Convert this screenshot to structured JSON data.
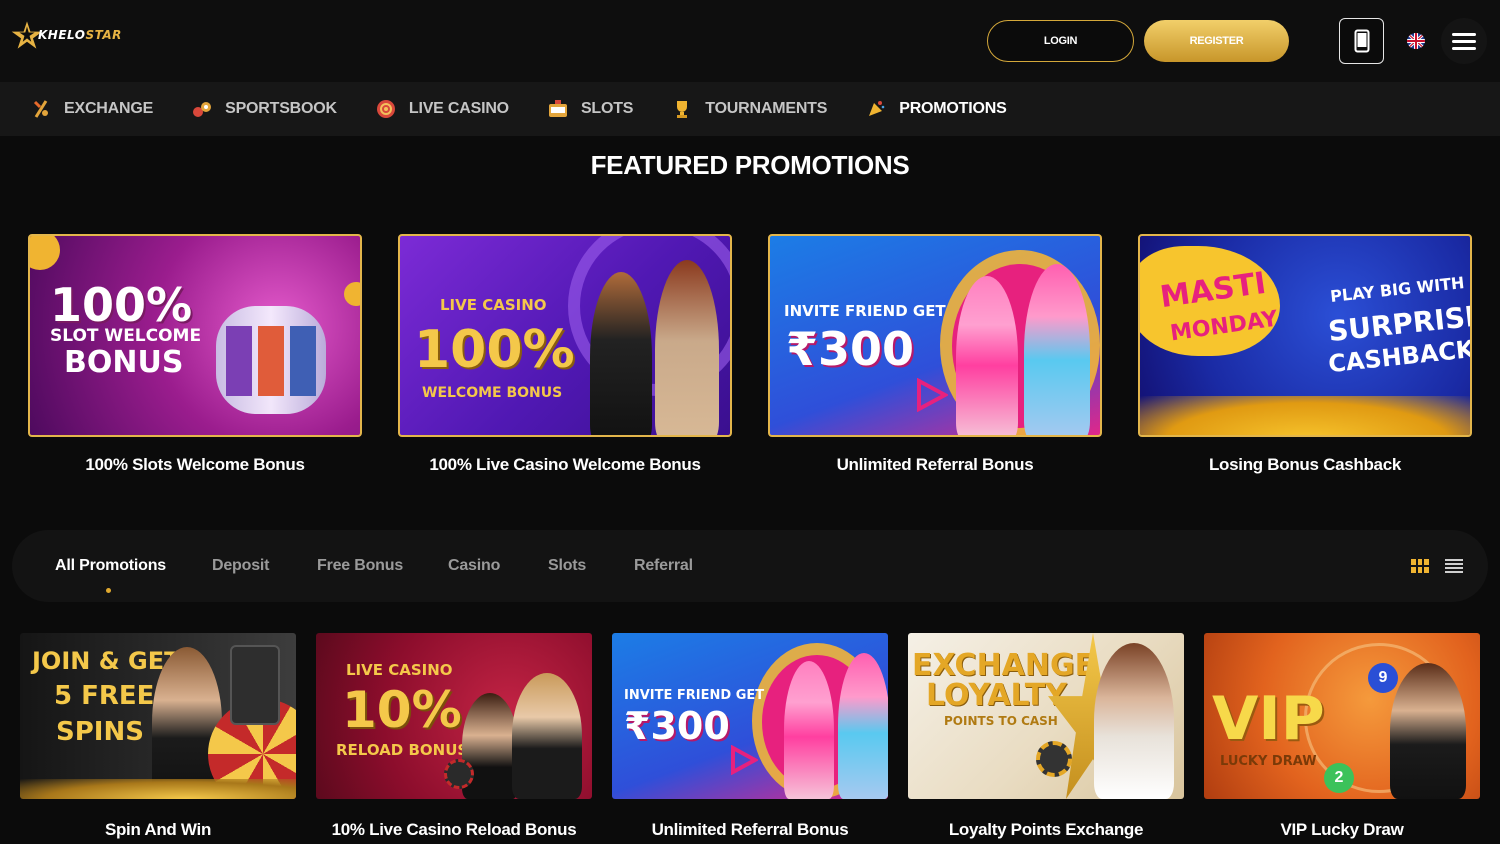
{
  "header": {
    "logo_text_1": "KHELO",
    "logo_text_2": "STAR",
    "login_label": "LOGIN",
    "register_label": "REGISTER"
  },
  "nav": {
    "items": [
      {
        "label": "EXCHANGE",
        "icon": "exchange-icon"
      },
      {
        "label": "SPORTSBOOK",
        "icon": "sportsbook-icon"
      },
      {
        "label": "LIVE CASINO",
        "icon": "live-casino-icon"
      },
      {
        "label": "SLOTS",
        "icon": "slots-icon"
      },
      {
        "label": "TOURNAMENTS",
        "icon": "trophy-icon"
      },
      {
        "label": "PROMOTIONS",
        "icon": "promotions-icon"
      }
    ],
    "active": "PROMOTIONS"
  },
  "featured": {
    "title": "FEATURED PROMOTIONS",
    "cards": [
      {
        "label": "100% Slots Welcome Bonus",
        "banner": {
          "line1": "100%",
          "line2": "SLOT WELCOME",
          "line3": "BONUS"
        }
      },
      {
        "label": "100% Live Casino Welcome Bonus",
        "banner": {
          "line1": "LIVE CASINO",
          "line2": "100%",
          "line3": "WELCOME BONUS"
        }
      },
      {
        "label": "Unlimited Referral Bonus",
        "banner": {
          "line1": "INVITE FRIEND GET",
          "line2": "₹300"
        }
      },
      {
        "label": "Losing Bonus Cashback",
        "banner": {
          "line1": "MASTI",
          "line2": "MONDAY",
          "line3": "PLAY BIG WITH",
          "line4": "SURPRISE",
          "line5": "CASHBACK!"
        }
      }
    ]
  },
  "filters": {
    "tabs": [
      "All Promotions",
      "Deposit",
      "Free Bonus",
      "Casino",
      "Slots",
      "Referral"
    ],
    "active": "All Promotions",
    "view": "grid"
  },
  "promotions": [
    {
      "label": "Spin And Win",
      "banner": {
        "line1": "JOIN & GET",
        "line2": "5 FREE",
        "line3": "SPINS"
      }
    },
    {
      "label": "10% Live Casino Reload Bonus",
      "banner": {
        "line1": "LIVE CASINO",
        "line2": "10%",
        "line3": "RELOAD BONUS"
      }
    },
    {
      "label": "Unlimited Referral Bonus",
      "banner": {
        "line1": "INVITE FRIEND GET",
        "line2": "₹300"
      }
    },
    {
      "label": "Loyalty Points Exchange",
      "banner": {
        "line1": "EXCHANGE",
        "line2": "LOYALTY",
        "line3": "POINTS TO CASH"
      }
    },
    {
      "label": "VIP Lucky Draw",
      "banner": {
        "line1": "VIP",
        "line2": "LUCKY DRAW"
      }
    }
  ],
  "colors": {
    "gold": "#e3b64b",
    "background": "#0b0b0b",
    "nav_background": "#171717",
    "active_dot": "#e0a92f"
  }
}
